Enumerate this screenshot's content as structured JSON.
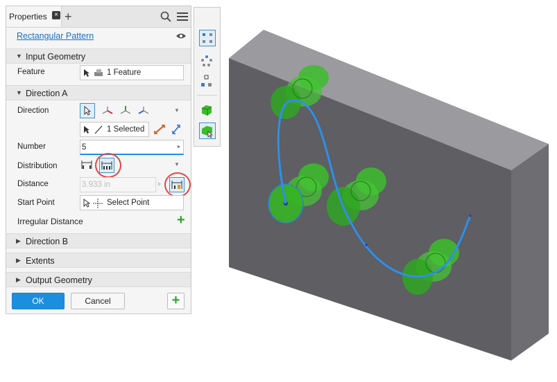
{
  "tab": {
    "label": "Properties"
  },
  "panel": {
    "title": "Rectangular Pattern"
  },
  "sections": {
    "input_geometry": "Input Geometry",
    "direction_a": "Direction A",
    "direction_b": "Direction B",
    "extents": "Extents",
    "output_geometry": "Output Geometry"
  },
  "fields": {
    "feature_label": "Feature",
    "feature_value": "1 Feature",
    "direction_label": "Direction",
    "direction_value": "1 Selected",
    "number_label": "Number",
    "number_value": "5",
    "distribution_label": "Distribution",
    "distance_label": "Distance",
    "distance_value": "3.933 in",
    "start_point_label": "Start Point",
    "start_point_value": "Select Point",
    "irregular_label": "Irregular Distance"
  },
  "buttons": {
    "ok": "OK",
    "cancel": "Cancel"
  },
  "colors": {
    "accent": "#1c8ee0",
    "highlight": "#e24545",
    "add": "#2ea52e",
    "part": "#6e6e73",
    "feature": "#3bbd2a",
    "path": "#2f8fe8"
  },
  "icons": [
    "close-icon",
    "add-tab-icon",
    "search-icon",
    "menu-icon",
    "eye-icon",
    "select-arrow-icon",
    "axis-icon",
    "add-icon",
    "pattern-tool-icon"
  ]
}
